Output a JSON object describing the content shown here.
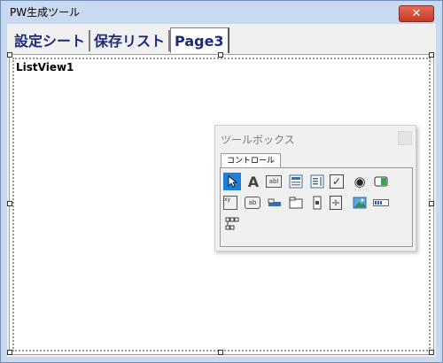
{
  "window": {
    "title": "PW生成ツール",
    "close_glyph": "✕"
  },
  "tabs": [
    {
      "label": "設定シート"
    },
    {
      "label": "保存リスト"
    },
    {
      "label": "Page3"
    }
  ],
  "listview": {
    "label": "ListView1"
  },
  "toolbox": {
    "title": "ツールボックス",
    "tab_label": "コントロール",
    "tools": [
      {
        "icon": "pointer-icon"
      },
      {
        "icon": "label-icon",
        "glyph": "A"
      },
      {
        "icon": "textbox-icon",
        "glyph": "abl"
      },
      {
        "icon": "combobox-icon"
      },
      {
        "icon": "listbox-icon"
      },
      {
        "icon": "checkbox-icon",
        "glyph": "✓"
      },
      {
        "icon": "option-button-icon",
        "glyph": "◉"
      },
      {
        "icon": "toggle-button-icon"
      },
      {
        "icon": "frame-icon",
        "glyph": "xy"
      },
      {
        "icon": "command-button-icon",
        "glyph": "ab"
      },
      {
        "icon": "tabstrip-icon"
      },
      {
        "icon": "multipage-icon"
      },
      {
        "icon": "scrollbar-icon"
      },
      {
        "icon": "spinbutton-icon",
        "glyph": "÷"
      },
      {
        "icon": "image-icon"
      },
      {
        "icon": "progressbar-icon"
      },
      {
        "icon": "treeview-icon",
        "glyph": "꠸"
      }
    ]
  }
}
